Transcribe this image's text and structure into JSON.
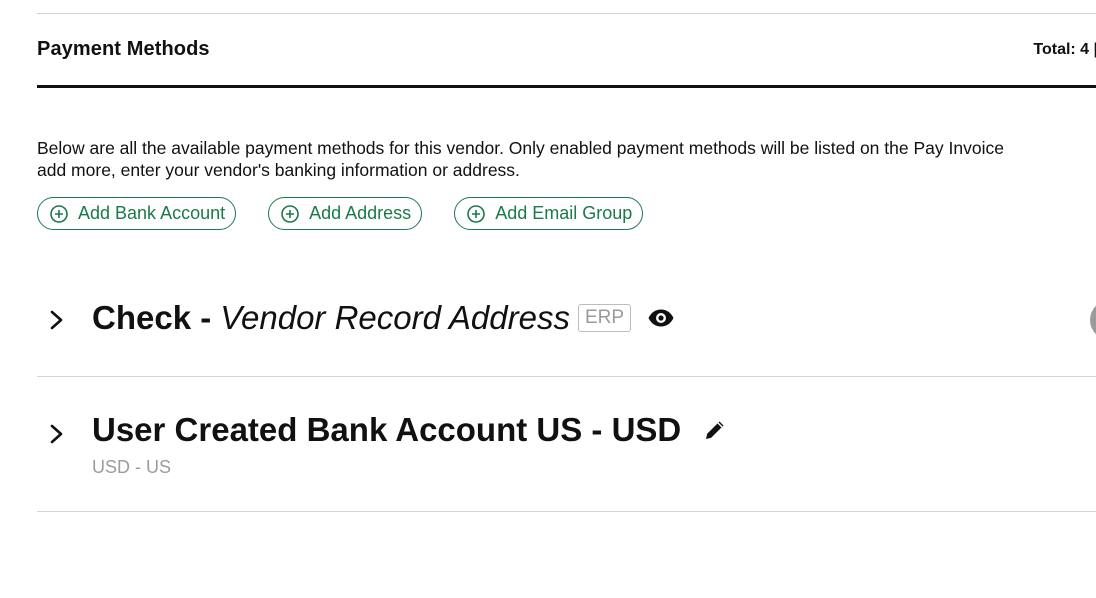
{
  "section": {
    "title": "Payment Methods",
    "total": "Total: 4 |"
  },
  "description": {
    "line1": "Below are all the available payment methods for this vendor. Only enabled payment methods will be listed on the Pay Invoice",
    "line2": "add more, enter your vendor's banking information or address."
  },
  "actions": [
    {
      "label": "Add Bank Account",
      "icon": "plus-circle-icon"
    },
    {
      "label": "Add Address",
      "icon": "plus-circle-icon"
    },
    {
      "label": "Add Email Group",
      "icon": "plus-circle-icon"
    }
  ],
  "payment_methods": [
    {
      "title": "Check -",
      "subtitle_italic": "Vendor Record Address",
      "badge": "ERP",
      "icon": "eye-icon"
    },
    {
      "title": "User Created Bank Account US - USD",
      "subtext": "USD - US",
      "icon": "pencil-icon"
    }
  ],
  "colors": {
    "accent_green": "#1a7a4a",
    "muted_text": "#9c9c9c"
  }
}
